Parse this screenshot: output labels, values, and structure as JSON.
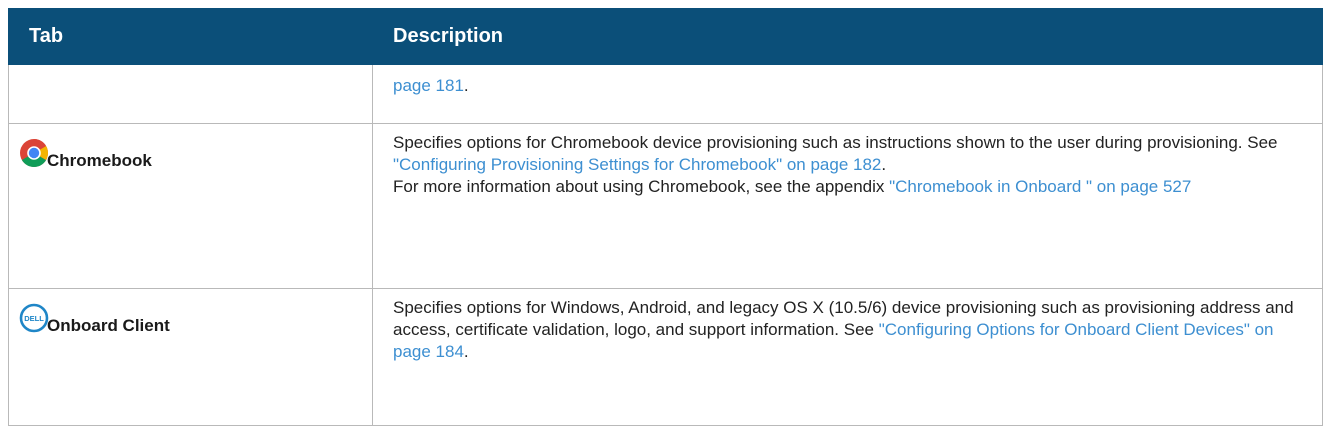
{
  "header": {
    "tab": "Tab",
    "description": "Description"
  },
  "rows": [
    {
      "tab": "",
      "description": {
        "link": "page 181",
        "after": "."
      }
    },
    {
      "tab": "Chromebook",
      "icon": "chrome-icon",
      "description": {
        "p1_text": "Specifies options for Chromebook device provisioning such as instructions shown to the user during provisioning. See ",
        "p1_link": "\"Configuring Provisioning Settings for Chromebook\" on page 182",
        "p1_after": ".",
        "p2_text": "For more information about using Chromebook, see the appendix ",
        "p2_link": "\"Chromebook in Onboard \" on page 527"
      }
    },
    {
      "tab": "Onboard Client",
      "icon": "dell-icon",
      "description": {
        "text": "Specifies options for Windows, Android, and legacy OS X (10.5/6) device provisioning such as provisioning address and access, certificate validation, logo, and support information. See ",
        "link": "\"Configuring Options for Onboard Client Devices\" on page 184",
        "after": "."
      }
    }
  ],
  "colors": {
    "header_bg": "#0b4f79",
    "link": "#3d8fd1",
    "border": "#b9b9b9"
  }
}
